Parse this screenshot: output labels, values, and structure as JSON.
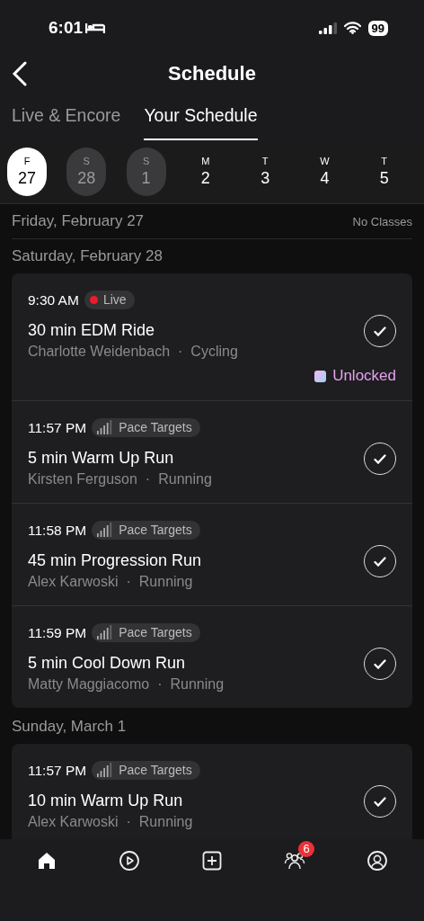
{
  "status_bar": {
    "time": "6:01",
    "battery": "99"
  },
  "header": {
    "title": "Schedule"
  },
  "tabs": [
    {
      "label": "Live & Encore",
      "selected": false
    },
    {
      "label": "Your Schedule",
      "selected": true
    }
  ],
  "days": [
    {
      "weekday": "F",
      "date": "27",
      "selected": true,
      "has_classes": false
    },
    {
      "weekday": "S",
      "date": "28",
      "selected": false,
      "has_classes": true
    },
    {
      "weekday": "S",
      "date": "1",
      "selected": false,
      "has_classes": true
    },
    {
      "weekday": "M",
      "date": "2",
      "selected": false,
      "has_classes": false
    },
    {
      "weekday": "T",
      "date": "3",
      "selected": false,
      "has_classes": false
    },
    {
      "weekday": "W",
      "date": "4",
      "selected": false,
      "has_classes": false
    },
    {
      "weekday": "T",
      "date": "5",
      "selected": false,
      "has_classes": false
    }
  ],
  "sections": [
    {
      "heading": "Friday, February 27",
      "note": "No Classes"
    },
    {
      "heading": "Saturday, February 28",
      "classes": [
        {
          "time": "9:30 AM",
          "tag": {
            "kind": "live",
            "label": "Live"
          },
          "title": "30 min EDM Ride",
          "instructor": "Charlotte Weidenbach",
          "separator": "·",
          "discipline": "Cycling",
          "checked": true,
          "unlocked": "Unlocked"
        },
        {
          "time": "11:57 PM",
          "tag": {
            "kind": "pace",
            "label": "Pace Targets"
          },
          "title": "5 min Warm Up Run",
          "instructor": "Kirsten Ferguson",
          "separator": "·",
          "discipline": "Running",
          "checked": true
        },
        {
          "time": "11:58 PM",
          "tag": {
            "kind": "pace",
            "label": "Pace Targets"
          },
          "title": "45 min Progression Run",
          "instructor": "Alex Karwoski",
          "separator": "·",
          "discipline": "Running",
          "checked": true
        },
        {
          "time": "11:59 PM",
          "tag": {
            "kind": "pace",
            "label": "Pace Targets"
          },
          "title": "5 min Cool Down Run",
          "instructor": "Matty Maggiacomo",
          "separator": "·",
          "discipline": "Running",
          "checked": true
        }
      ]
    },
    {
      "heading": "Sunday, March 1",
      "classes": [
        {
          "time": "11:57 PM",
          "tag": {
            "kind": "pace",
            "label": "Pace Targets"
          },
          "title": "10 min Warm Up Run",
          "instructor": "Alex Karwoski",
          "separator": "·",
          "discipline": "Running",
          "checked": true
        }
      ]
    }
  ],
  "tab_bar": [
    {
      "kind": "home",
      "selected": true
    },
    {
      "kind": "play",
      "selected": false
    },
    {
      "kind": "add",
      "selected": false
    },
    {
      "kind": "community",
      "selected": false,
      "badge": "6"
    },
    {
      "kind": "profile",
      "selected": false
    }
  ]
}
